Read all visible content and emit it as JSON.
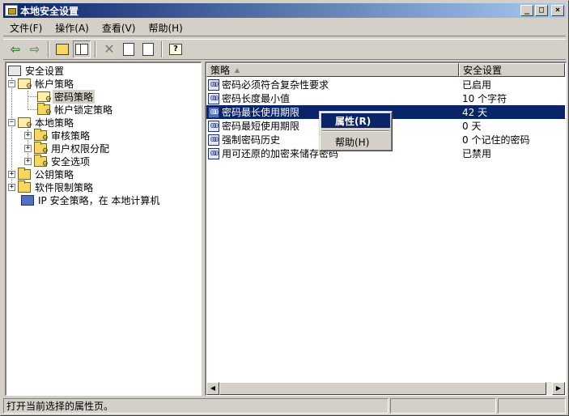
{
  "window": {
    "title": "本地安全设置",
    "controls": {
      "minimize": "_",
      "maximize": "□",
      "close": "×"
    }
  },
  "menu": [
    {
      "label": "文件(F)"
    },
    {
      "label": "操作(A)"
    },
    {
      "label": "查看(V)"
    },
    {
      "label": "帮助(H)"
    }
  ],
  "toolbar": {
    "buttons": [
      "back-icon",
      "forward-icon",
      "up-folder-icon",
      "show-hide-tree-icon",
      "delete-icon",
      "properties-icon",
      "export-list-icon",
      "help-icon"
    ]
  },
  "tree": {
    "root": "安全设置",
    "account_policy": "帐户策略",
    "password_policy": "密码策略",
    "lockout_policy": "帐户锁定策略",
    "local_policy": "本地策略",
    "audit_policy": "审核策略",
    "user_rights": "用户权限分配",
    "security_options": "安全选项",
    "public_key": "公钥策略",
    "software_restriction": "软件限制策略",
    "ip_security": "IP 安全策略，在 本地计算机"
  },
  "list": {
    "columns": {
      "policy": "策略",
      "setting": "安全设置"
    },
    "rows": [
      {
        "name": "密码必须符合复杂性要求",
        "value": "已启用"
      },
      {
        "name": "密码长度最小值",
        "value": "10 个字符"
      },
      {
        "name": "密码最长使用期限",
        "value": "42 天"
      },
      {
        "name": "密码最短使用期限",
        "value": "0 天"
      },
      {
        "name": "强制密码历史",
        "value": "0 个记住的密码"
      },
      {
        "name": "用可还原的加密来储存密码",
        "value": "已禁用"
      }
    ],
    "selected_index": 2
  },
  "context_menu": {
    "properties": "属性(R)",
    "help": "帮助(H)"
  },
  "status": {
    "text": "打开当前选择的属性页。",
    "cell2": "",
    "cell3": ""
  },
  "colors": {
    "selection": "#0a246a",
    "titlebar_start": "#0a246a",
    "titlebar_end": "#a6caf0",
    "face": "#d4d0c8"
  }
}
